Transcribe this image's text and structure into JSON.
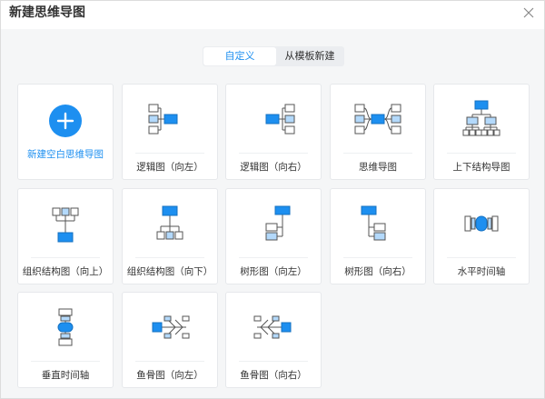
{
  "dialog": {
    "title": "新建思维导图",
    "close_label": "×"
  },
  "tabs": [
    {
      "label": "自定义",
      "active": true
    },
    {
      "label": "从模板新建",
      "active": false
    }
  ],
  "blank_card": {
    "label": "新建空白思维导图",
    "icon": "plus-icon"
  },
  "templates": [
    {
      "label": "逻辑图（向左）",
      "icon": "logic-left-icon"
    },
    {
      "label": "逻辑图（向右）",
      "icon": "logic-right-icon"
    },
    {
      "label": "思维导图",
      "icon": "mindmap-icon"
    },
    {
      "label": "上下结构导图",
      "icon": "updown-structure-icon"
    },
    {
      "label": "组织结构图（向上）",
      "icon": "org-chart-up-icon"
    },
    {
      "label": "组织结构图（向下）",
      "icon": "org-chart-down-icon"
    },
    {
      "label": "树形图（向左）",
      "icon": "tree-left-icon"
    },
    {
      "label": "树形图（向右）",
      "icon": "tree-right-icon"
    },
    {
      "label": "水平时间轴",
      "icon": "horizontal-timeline-icon"
    },
    {
      "label": "垂直时间轴",
      "icon": "vertical-timeline-icon"
    },
    {
      "label": "鱼骨图（向左）",
      "icon": "fishbone-left-icon"
    },
    {
      "label": "鱼骨图（向右）",
      "icon": "fishbone-right-icon"
    }
  ],
  "colors": {
    "accent": "#1d8ff0",
    "node_light": "#b3d9fb",
    "line": "#555555"
  }
}
